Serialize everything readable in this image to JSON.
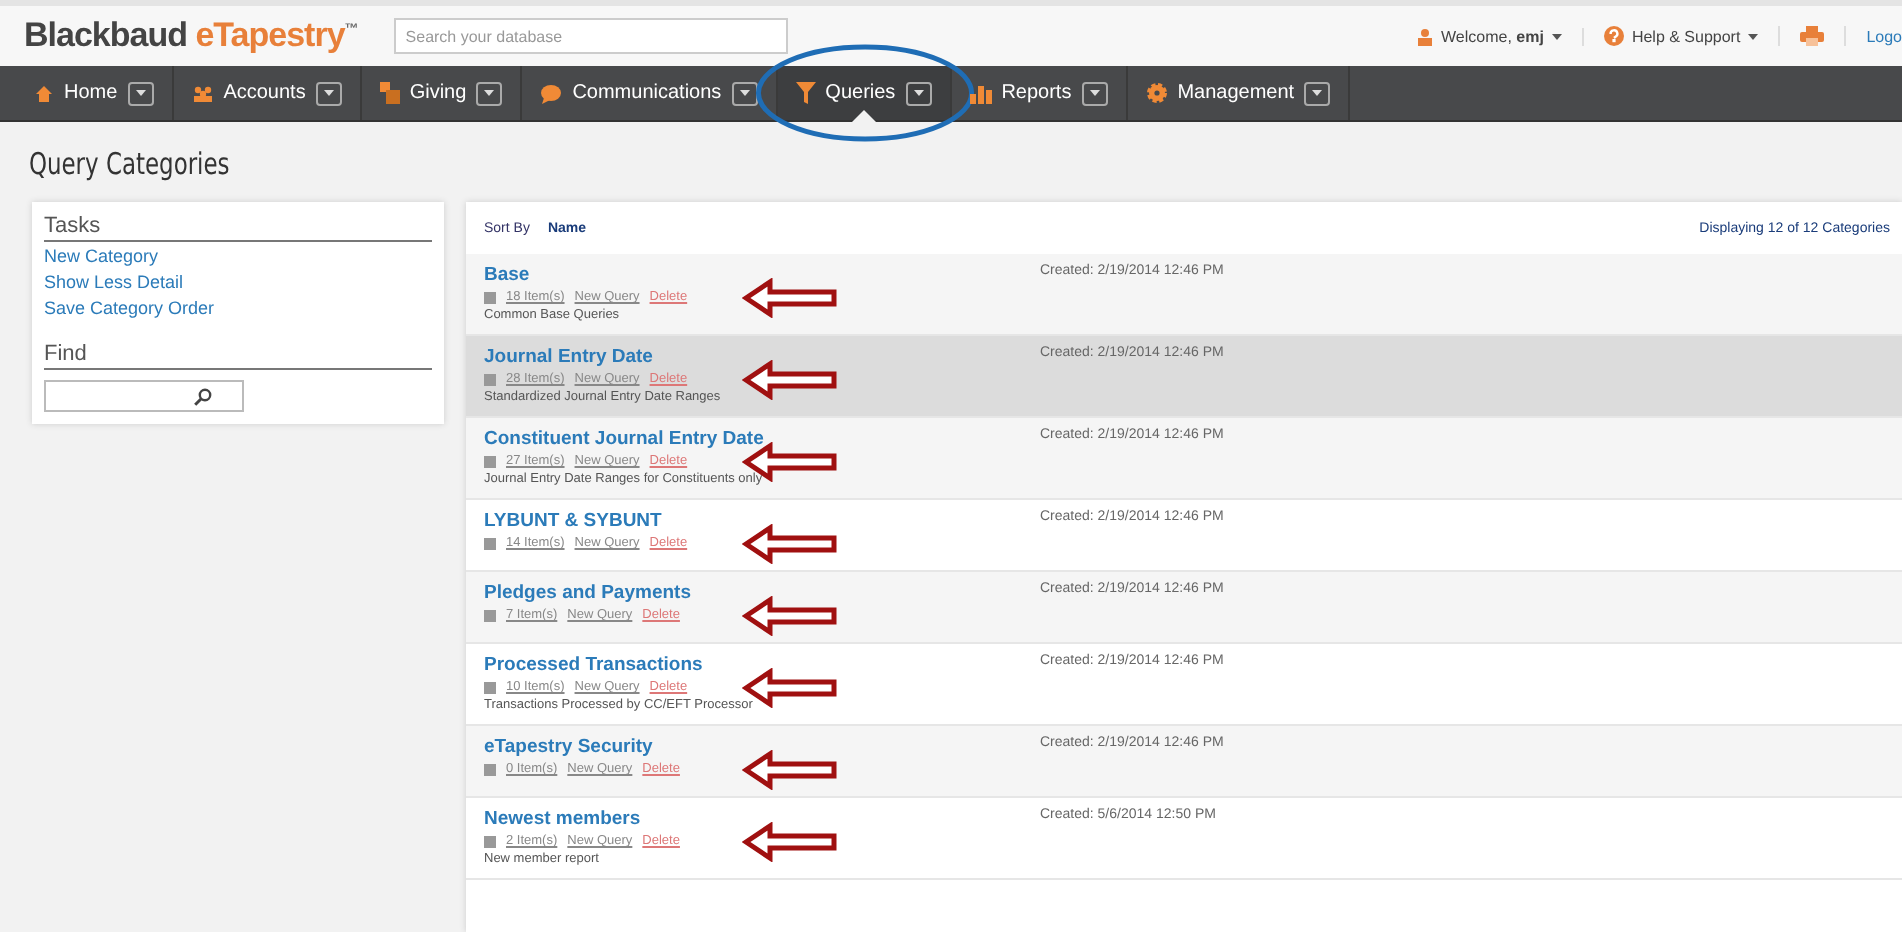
{
  "header": {
    "brand": "Blackbaud",
    "product": "eTapestry",
    "trademark": "™",
    "search": {
      "placeholder": "Search your database"
    },
    "welcome": "Welcome, **emj**",
    "help": "Help & Support",
    "logout": "Logo"
  },
  "nav": [
    {
      "label": "Home",
      "kind": "home",
      "selected": false,
      "circled": false
    },
    {
      "label": "Accounts",
      "kind": "people",
      "selected": false,
      "circled": false
    },
    {
      "label": "Giving",
      "kind": "gift",
      "selected": false,
      "circled": false
    },
    {
      "label": "Communications",
      "kind": "bubble",
      "selected": false,
      "circled": false
    },
    {
      "label": "Queries",
      "kind": "funnel",
      "selected": true,
      "circled": true
    },
    {
      "label": "Reports",
      "kind": "chart",
      "selected": false,
      "circled": false
    },
    {
      "label": "Management",
      "kind": "gear",
      "selected": false,
      "circled": false
    }
  ],
  "page_title": "Query Categories",
  "tasks": {
    "title": "Tasks",
    "links": [
      "New Category",
      "Show Less Detail",
      "Save Category Order"
    ],
    "find_title": "Find"
  },
  "list": {
    "sort_label": "Sort By",
    "sort_value": "Name",
    "count": "Displaying 12 of 12 Categories",
    "categories": [
      {
        "name": "Base",
        "items": "18 Item(s)",
        "new_query": "New Query",
        "delete": "Delete",
        "description": "Common Base Queries",
        "created": "Created: 2/19/2014 12:46 PM",
        "highlighted": false,
        "arrow": true
      },
      {
        "name": "Journal Entry Date",
        "items": "28 Item(s)",
        "new_query": "New Query",
        "delete": "Delete",
        "description": "Standardized Journal Entry Date Ranges",
        "created": "Created: 2/19/2014 12:46 PM",
        "highlighted": true,
        "arrow": true
      },
      {
        "name": "Constituent Journal Entry Date",
        "items": "27 Item(s)",
        "new_query": "New Query",
        "delete": "Delete",
        "description": "Journal Entry Date Ranges for Constituents only",
        "created": "Created: 2/19/2014 12:46 PM",
        "highlighted": false,
        "arrow": true
      },
      {
        "name": "LYBUNT & SYBUNT",
        "items": "14 Item(s)",
        "new_query": "New Query",
        "delete": "Delete",
        "created": "Created: 2/19/2014 12:46 PM",
        "highlighted": false,
        "arrow": true
      },
      {
        "name": "Pledges and Payments",
        "items": "7 Item(s)",
        "new_query": "New Query",
        "delete": "Delete",
        "created": "Created: 2/19/2014 12:46 PM",
        "highlighted": false,
        "arrow": true
      },
      {
        "name": "Processed Transactions",
        "items": "10 Item(s)",
        "new_query": "New Query",
        "delete": "Delete",
        "description": "Transactions Processed by CC/EFT Processor",
        "created": "Created: 2/19/2014 12:46 PM",
        "highlighted": false,
        "arrow": true
      },
      {
        "name": "eTapestry Security",
        "items": "0 Item(s)",
        "new_query": "New Query",
        "delete": "Delete",
        "created": "Created: 2/19/2014 12:46 PM",
        "highlighted": false,
        "arrow": true
      },
      {
        "name": "Newest members",
        "items": "2 Item(s)",
        "new_query": "New Query",
        "delete": "Delete",
        "description": "New member report",
        "created": "Created: 5/6/2014 12:50 PM",
        "highlighted": false,
        "arrow": true
      }
    ]
  }
}
